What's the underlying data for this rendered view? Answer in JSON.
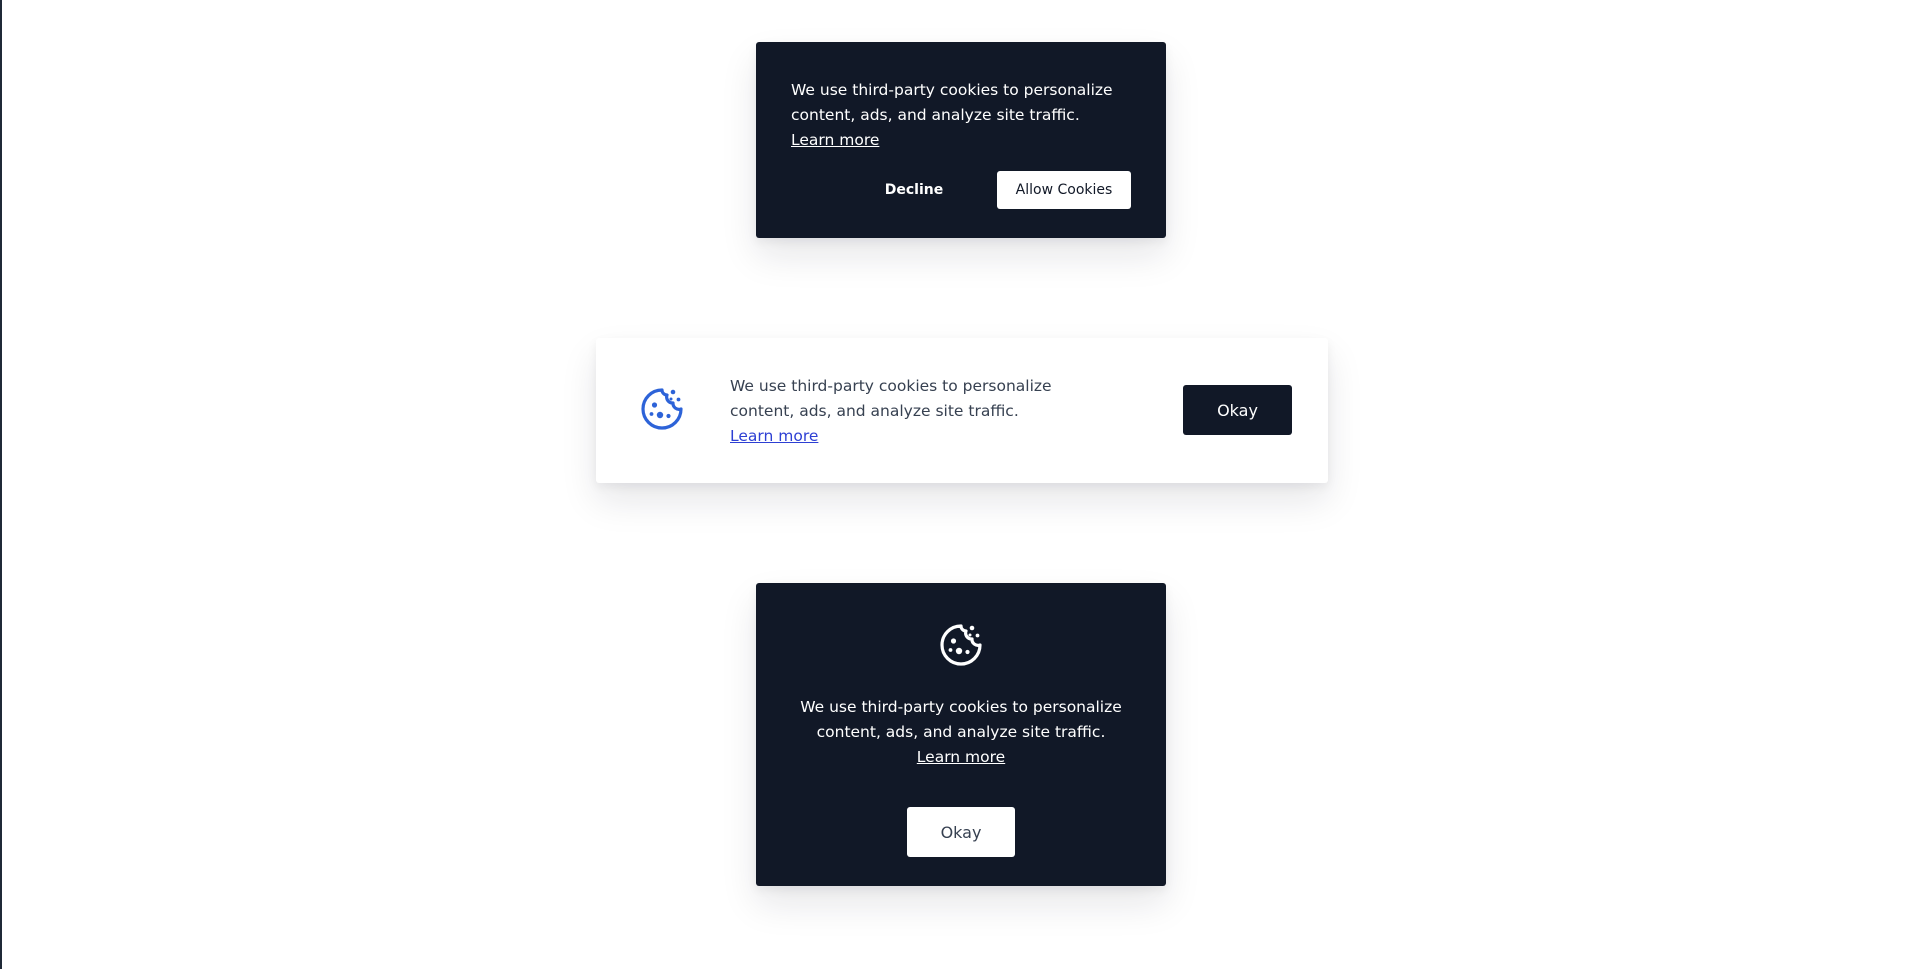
{
  "colors": {
    "dark_background": "#111827",
    "accent_blue": "#2d63d8",
    "link_blue": "#2d3fd3"
  },
  "banner_top": {
    "message": "We use third-party cookies to personalize content, ads, and analyze site traffic.",
    "learn_more": "Learn more",
    "decline_label": "Decline",
    "allow_label": "Allow Cookies"
  },
  "banner_middle": {
    "icon": "cookie-icon",
    "message": "We use third-party cookies to personalize content, ads, and analyze site traffic.",
    "learn_more": "Learn more",
    "okay_label": "Okay"
  },
  "banner_bottom": {
    "icon": "cookie-icon",
    "message": "We use third-party cookies to personalize content, ads, and analyze site traffic.",
    "learn_more": "Learn more",
    "okay_label": "Okay"
  }
}
